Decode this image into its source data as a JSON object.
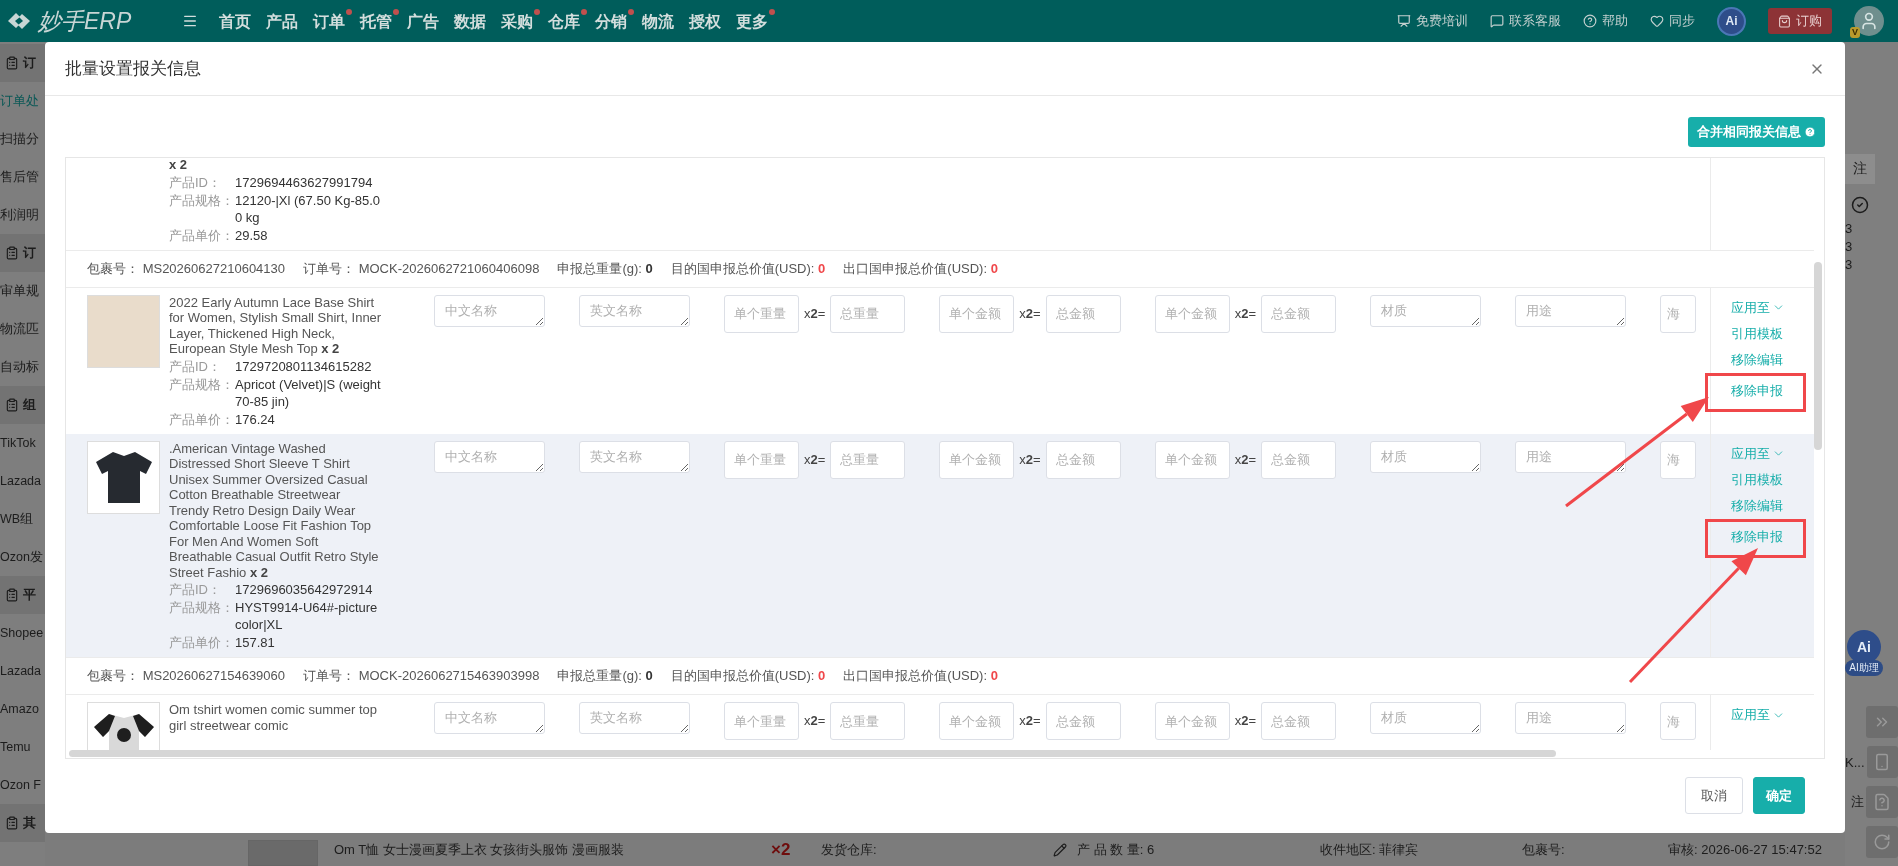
{
  "nav": {
    "logo": "妙手ERP",
    "items": [
      {
        "label": "首页",
        "dot": false
      },
      {
        "label": "产品",
        "dot": false
      },
      {
        "label": "订单",
        "dot": true
      },
      {
        "label": "托管",
        "dot": true
      },
      {
        "label": "广告",
        "dot": false
      },
      {
        "label": "数据",
        "dot": false
      },
      {
        "label": "采购",
        "dot": true
      },
      {
        "label": "仓库",
        "dot": true
      },
      {
        "label": "分销",
        "dot": true
      },
      {
        "label": "物流",
        "dot": false
      },
      {
        "label": "授权",
        "dot": false
      },
      {
        "label": "更多",
        "dot": true
      }
    ],
    "tools": [
      {
        "kind": "training",
        "label": "免费培训"
      },
      {
        "kind": "service",
        "label": "联系客服"
      },
      {
        "kind": "help",
        "label": "帮助"
      },
      {
        "kind": "sync",
        "label": "同步"
      }
    ],
    "ai": "Ai",
    "order_button": "订购",
    "avatar_badge": "V"
  },
  "sidebar": {
    "items": [
      {
        "kind": "group",
        "label": "订"
      },
      {
        "kind": "link",
        "label": "订单处",
        "selected": true
      },
      {
        "kind": "link",
        "label": "扫描分",
        "selected": false
      },
      {
        "kind": "link",
        "label": "售后管",
        "selected": false
      },
      {
        "kind": "link",
        "label": "利润明",
        "selected": false
      },
      {
        "kind": "group",
        "label": "订"
      },
      {
        "kind": "link",
        "label": "审单规",
        "selected": false
      },
      {
        "kind": "link",
        "label": "物流匹",
        "selected": false
      },
      {
        "kind": "link",
        "label": "自动标",
        "selected": false
      },
      {
        "kind": "group",
        "label": "组"
      },
      {
        "kind": "link",
        "label": "TikTok",
        "selected": false
      },
      {
        "kind": "link",
        "label": "Lazada",
        "selected": false
      },
      {
        "kind": "link",
        "label": "WB组",
        "selected": false
      },
      {
        "kind": "link",
        "label": "Ozon发",
        "selected": false
      },
      {
        "kind": "group",
        "label": "平"
      },
      {
        "kind": "link",
        "label": "Shopee",
        "selected": false
      },
      {
        "kind": "link",
        "label": "Lazada",
        "selected": false
      },
      {
        "kind": "link",
        "label": "Amazo",
        "selected": false
      },
      {
        "kind": "link",
        "label": "Temu",
        "selected": false
      },
      {
        "kind": "link",
        "label": "Ozon F",
        "selected": false
      },
      {
        "kind": "group",
        "label": "其"
      }
    ]
  },
  "right_rail": {
    "note": "注",
    "digits": [
      "3",
      "3",
      "3"
    ],
    "assistant_icon": "Ai",
    "assistant": "AI助理",
    "tool_rows": [
      {
        "kind": "expand"
      },
      {
        "kind": "phone",
        "label": "K..."
      },
      {
        "kind": "help",
        "label": "注"
      },
      {
        "kind": "refresh"
      }
    ]
  },
  "bottom_row": {
    "title": "Om T恤 女士漫画夏季上衣 女孩街头服饰 漫画服装",
    "qty": "×2",
    "warehouse": "发货仓库:",
    "count": "产 品 数 量: 6",
    "region": "收件地区: 菲律宾",
    "package": "包裹号:",
    "review": "审核: 2026-06-27 15:47:52"
  },
  "dialog": {
    "title": "批量设置报关信息",
    "merge_button": "合并相同报关信息",
    "rows": [
      {
        "kind": "product",
        "hovered": false,
        "qty": "x 2",
        "id_label": "产品ID：",
        "id": "1729694463627991794",
        "spec_label": "产品规格：",
        "spec": "12120-|Xl (67.50 Kg-85.00 kg",
        "price_label": "产品单价：",
        "price": "29.58"
      },
      {
        "kind": "package",
        "parts": [
          {
            "label": "包裹号：",
            "value": "MS20260627210604130",
            "kind": "plain"
          },
          {
            "label": "订单号：",
            "value": "MOCK-2026062721060406098",
            "kind": "plain"
          },
          {
            "label": "申报总重量(g):",
            "value": "0",
            "kind": "bold"
          },
          {
            "label": "目的国申报总价值(USD):",
            "value": "0",
            "kind": "alert"
          },
          {
            "label": "出口国申报总价值(USD):",
            "value": "0",
            "kind": "alert"
          }
        ]
      },
      {
        "kind": "product",
        "hovered": false,
        "thumb": {
          "kind": "photo"
        },
        "title": "2022 Early Autumn Lace Base Shirt for Women, Stylish Small Shirt, Inner Layer, Thickened High Neck, European Style Mesh Top",
        "qty": "x 2",
        "id_label": "产品ID：",
        "id": "1729720801134615282",
        "spec_label": "产品规格：",
        "spec": "Apricot (Velvet)|S (weight 70-85 jin)",
        "price_label": "产品单价：",
        "price": "176.24",
        "fields": [
          {
            "kind": "textarea",
            "placeholder": "中文名称"
          },
          {
            "kind": "textarea",
            "placeholder": "英文名称"
          },
          {
            "kind": "input",
            "placeholder": "单个重量"
          },
          {
            "kind": "multiplier",
            "text": "x**2**="
          },
          {
            "kind": "input",
            "placeholder": "总重量"
          },
          {
            "kind": "input",
            "placeholder": "单个金额"
          },
          {
            "kind": "multiplier",
            "text": "x**2**="
          },
          {
            "kind": "input",
            "placeholder": "总金额"
          },
          {
            "kind": "input",
            "placeholder": "单个金额"
          },
          {
            "kind": "multiplier",
            "text": "x**2**="
          },
          {
            "kind": "input",
            "placeholder": "总金额"
          },
          {
            "kind": "textarea",
            "placeholder": "材质"
          },
          {
            "kind": "textarea",
            "placeholder": "用途"
          },
          {
            "kind": "stub",
            "placeholder": "海"
          }
        ],
        "actions": [
          {
            "kind": "dropdown",
            "label": "应用至",
            "highlighted": false
          },
          {
            "kind": "link",
            "label": "引用模板",
            "highlighted": false
          },
          {
            "kind": "link",
            "label": "移除编辑",
            "highlighted": false
          },
          {
            "kind": "link",
            "label": "移除申报",
            "highlighted": true
          }
        ]
      },
      {
        "kind": "product",
        "hovered": true,
        "thumb": {
          "kind": "dark-tshirt"
        },
        "title": ".American Vintage Washed Distressed Short Sleeve T Shirt Unisex Summer Oversized Casual Cotton Breathable Streetwear Trendy Retro Design Daily Wear Comfortable Loose Fit Fashion Top For Men And Women Soft Breathable Casual Outfit Retro Style Street Fashio",
        "qty": "x 2",
        "id_label": "产品ID：",
        "id": "1729696035642972914",
        "spec_label": "产品规格：",
        "spec": "HYST9914-U64#-picture color|XL",
        "price_label": "产品单价：",
        "price": "157.81",
        "fields": [
          {
            "kind": "textarea",
            "placeholder": "中文名称"
          },
          {
            "kind": "textarea",
            "placeholder": "英文名称"
          },
          {
            "kind": "input",
            "placeholder": "单个重量"
          },
          {
            "kind": "multiplier",
            "text": "x**2**="
          },
          {
            "kind": "input",
            "placeholder": "总重量"
          },
          {
            "kind": "input",
            "placeholder": "单个金额"
          },
          {
            "kind": "multiplier",
            "text": "x**2**="
          },
          {
            "kind": "input",
            "placeholder": "总金额"
          },
          {
            "kind": "input",
            "placeholder": "单个金额"
          },
          {
            "kind": "multiplier",
            "text": "x**2**="
          },
          {
            "kind": "input",
            "placeholder": "总金额"
          },
          {
            "kind": "textarea",
            "placeholder": "材质"
          },
          {
            "kind": "textarea",
            "placeholder": "用途"
          },
          {
            "kind": "stub",
            "placeholder": "海"
          }
        ],
        "actions": [
          {
            "kind": "dropdown",
            "label": "应用至",
            "highlighted": false
          },
          {
            "kind": "link",
            "label": "引用模板",
            "highlighted": false
          },
          {
            "kind": "link",
            "label": "移除编辑",
            "highlighted": false
          },
          {
            "kind": "link",
            "label": "移除申报",
            "highlighted": true
          }
        ]
      },
      {
        "kind": "package",
        "parts": [
          {
            "label": "包裹号：",
            "value": "MS20260627154639060",
            "kind": "plain"
          },
          {
            "label": "订单号：",
            "value": "MOCK-2026062715463903998",
            "kind": "plain"
          },
          {
            "label": "申报总重量(g):",
            "value": "0",
            "kind": "bold"
          },
          {
            "label": "目的国申报总价值(USD):",
            "value": "0",
            "kind": "alert"
          },
          {
            "label": "出口国申报总价值(USD):",
            "value": "0",
            "kind": "alert"
          }
        ]
      },
      {
        "kind": "product",
        "hovered": false,
        "thumb": {
          "kind": "raglan-tshirt"
        },
        "title": "Om tshirt women comic summer top girl streetwear comic",
        "fields": [
          {
            "kind": "textarea",
            "placeholder": "中文名称"
          },
          {
            "kind": "textarea",
            "placeholder": "英文名称"
          },
          {
            "kind": "input",
            "placeholder": "单个重量"
          },
          {
            "kind": "multiplier",
            "text": "x**2**="
          },
          {
            "kind": "input",
            "placeholder": "总重量"
          },
          {
            "kind": "input",
            "placeholder": "单个金额"
          },
          {
            "kind": "multiplier",
            "text": "x**2**="
          },
          {
            "kind": "input",
            "placeholder": "总金额"
          },
          {
            "kind": "input",
            "placeholder": "单个金额"
          },
          {
            "kind": "multiplier",
            "text": "x**2**="
          },
          {
            "kind": "input",
            "placeholder": "总金额"
          },
          {
            "kind": "textarea",
            "placeholder": "材质"
          },
          {
            "kind": "textarea",
            "placeholder": "用途"
          },
          {
            "kind": "stub",
            "placeholder": "海"
          }
        ],
        "actions": [
          {
            "kind": "dropdown",
            "label": "应用至",
            "highlighted": false
          }
        ]
      }
    ],
    "buttons": [
      {
        "kind": "secondary",
        "label": "取消"
      },
      {
        "kind": "primary",
        "label": "确定"
      }
    ]
  }
}
